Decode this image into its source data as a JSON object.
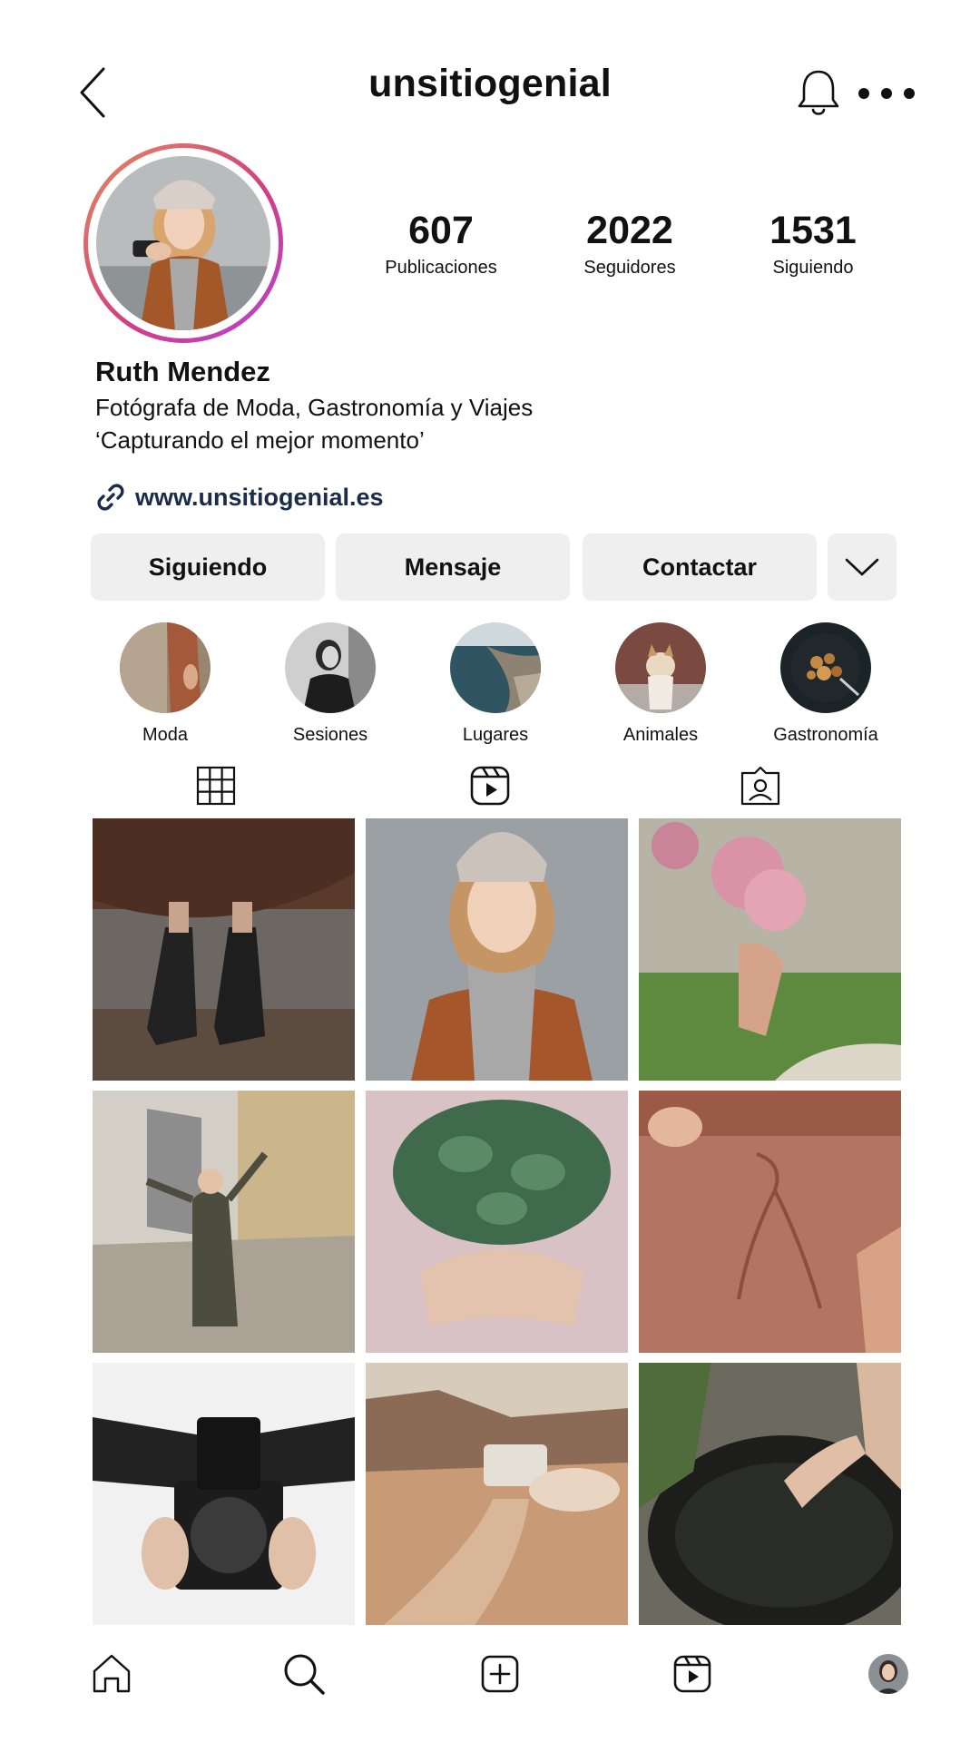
{
  "header": {
    "username": "unsitiogenial",
    "icons": [
      "back-arrow-icon",
      "bell-icon",
      "more-dots-icon"
    ]
  },
  "profile": {
    "stats": [
      {
        "value": "607",
        "label": "Publicaciones"
      },
      {
        "value": "2022",
        "label": "Seguidores"
      },
      {
        "value": "1531",
        "label": "Siguiendo"
      }
    ],
    "name": "Ruth Mendez",
    "bio": [
      "Fotógrafa de Moda, Gastronomía y Viajes",
      "‘Capturando el mejor momento’"
    ],
    "link": "www.unsitiogenial.es",
    "ring_colors": [
      "#e58a5c",
      "#d2407f",
      "#b640d8"
    ]
  },
  "actions": {
    "following_label": "Siguiendo",
    "message_label": "Mensaje",
    "contact_label": "Contactar",
    "more_icon": "chevron-down-icon"
  },
  "highlights": [
    {
      "label": "Moda"
    },
    {
      "label": "Sesiones"
    },
    {
      "label": "Lugares"
    },
    {
      "label": "Animales"
    },
    {
      "label": "Gastronomía"
    }
  ],
  "tabs": [
    "grid-icon",
    "reels-icon",
    "tagged-icon"
  ],
  "grid": [
    "boots-photo",
    "woman-beanie-photo",
    "cherry-blossom-photo",
    "street-dance-photo",
    "plant-hands-photo",
    "dress-photo",
    "camera-hands-photo",
    "desert-van-photo",
    "water-hand-photo"
  ],
  "bottom_nav": [
    "home-icon",
    "search-icon",
    "add-post-icon",
    "reels-icon",
    "profile-avatar-icon"
  ]
}
